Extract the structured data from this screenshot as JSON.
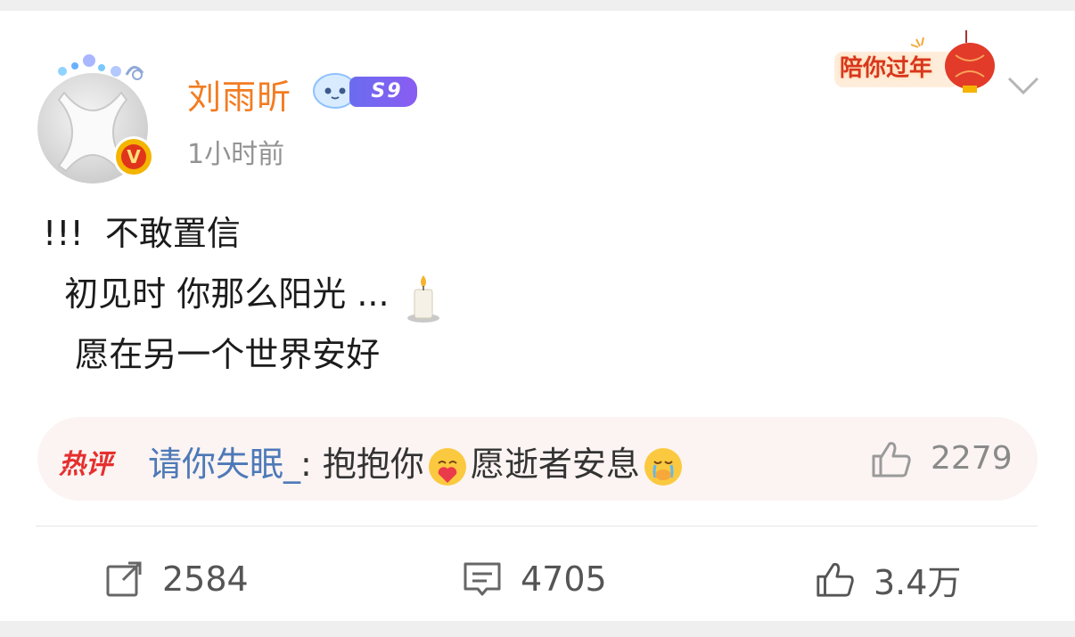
{
  "post": {
    "username": "刘雨昕",
    "level_badge": "S9",
    "time": "1小时前",
    "festival_badge": "陪你过年",
    "lines": [
      "!!!  不敢置信",
      "  初见时 你那么阳光 ...",
      "   愿在另一个世界安好"
    ]
  },
  "hot_comment": {
    "tag": "热评",
    "user": "请你失眠_",
    "separator": ": ",
    "text_1": "抱抱你",
    "text_2": "愿逝者安息",
    "likes": "2279"
  },
  "actions": {
    "repost_count": "2584",
    "comment_count": "4705",
    "like_count": "3.4万"
  },
  "colors": {
    "username": "#f27c22",
    "hot_tag": "#e5302f",
    "hot_user": "#4e79b8",
    "level_badge": "#7a62f0"
  },
  "icons": [
    "verified-badge-icon",
    "candle-icon",
    "hug-emoji-icon",
    "crying-emoji-icon",
    "thumbs-up-icon",
    "repost-icon",
    "comment-icon",
    "chevron-down-icon"
  ]
}
